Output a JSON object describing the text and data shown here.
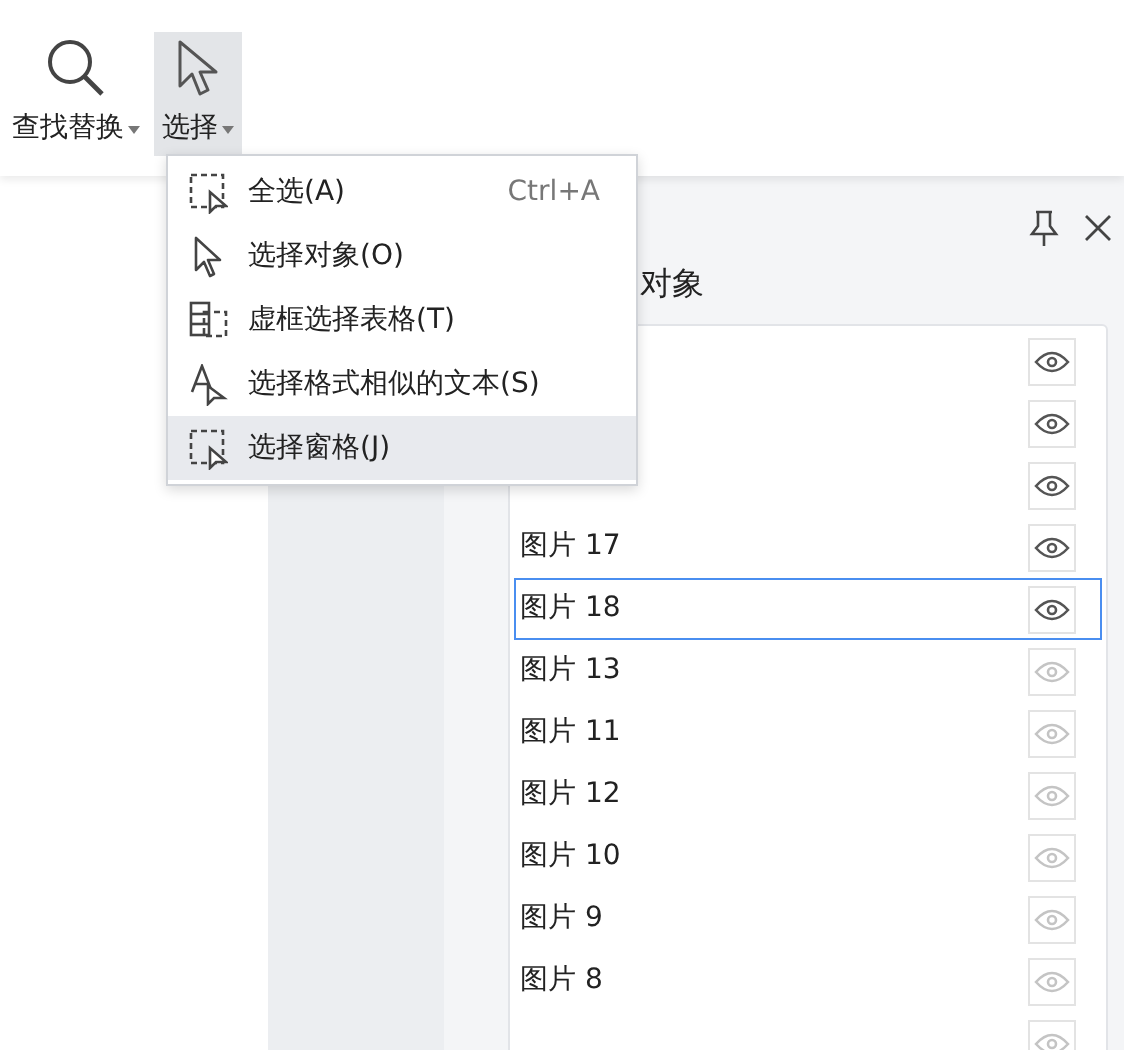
{
  "toolbar": [
    {
      "label": "查找替换",
      "selected": false
    },
    {
      "label": "选择",
      "selected": true
    }
  ],
  "menu": [
    {
      "label": "全选(A)",
      "shortcut": "Ctrl+A",
      "selected": false
    },
    {
      "label": "选择对象(O)",
      "selected": false
    },
    {
      "label": "虚框选择表格(T)",
      "selected": false
    },
    {
      "label": "选择格式相似的文本(S)",
      "selected": false
    },
    {
      "label": "选择窗格(J)",
      "selected": true
    }
  ],
  "panel": {
    "heading": "对象",
    "objects": [
      {
        "visible": true,
        "selected": false
      },
      {
        "visible": true,
        "selected": false
      },
      {
        "visible": true,
        "selected": false
      },
      {
        "name": "图片 17",
        "visible": true,
        "selected": false
      },
      {
        "name": "图片 18",
        "visible": true,
        "selected": true
      },
      {
        "name": "图片 13",
        "visible": false,
        "selected": false
      },
      {
        "name": "图片 11",
        "visible": false,
        "selected": false
      },
      {
        "name": "图片 12",
        "visible": false,
        "selected": false
      },
      {
        "name": "图片 10",
        "visible": false,
        "selected": false
      },
      {
        "name": "图片 9",
        "visible": false,
        "selected": false
      },
      {
        "name": "图片 8",
        "visible": false,
        "selected": false
      },
      {
        "visible": false,
        "selected": false
      }
    ]
  }
}
